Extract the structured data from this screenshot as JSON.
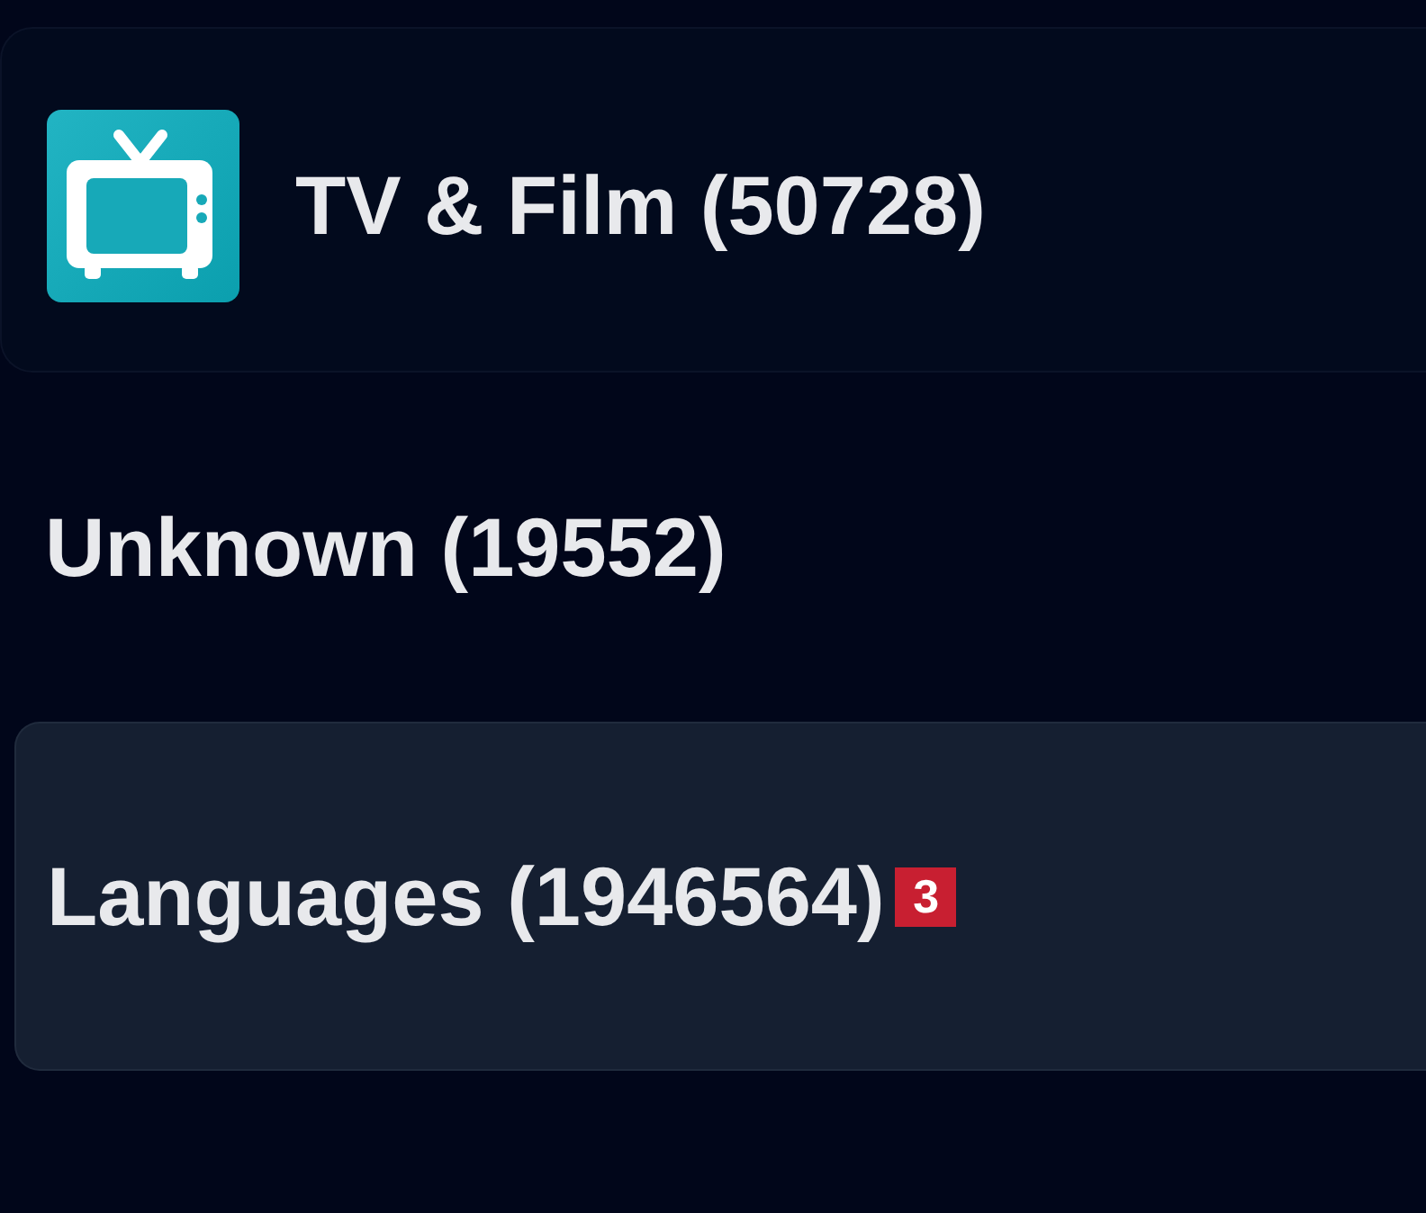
{
  "category": {
    "title": "TV & Film (50728)"
  },
  "items": [
    {
      "label": "Unknown (19552)",
      "selected": false
    },
    {
      "label": "Languages (1946564)",
      "selected": true,
      "badge": "3"
    }
  ]
}
